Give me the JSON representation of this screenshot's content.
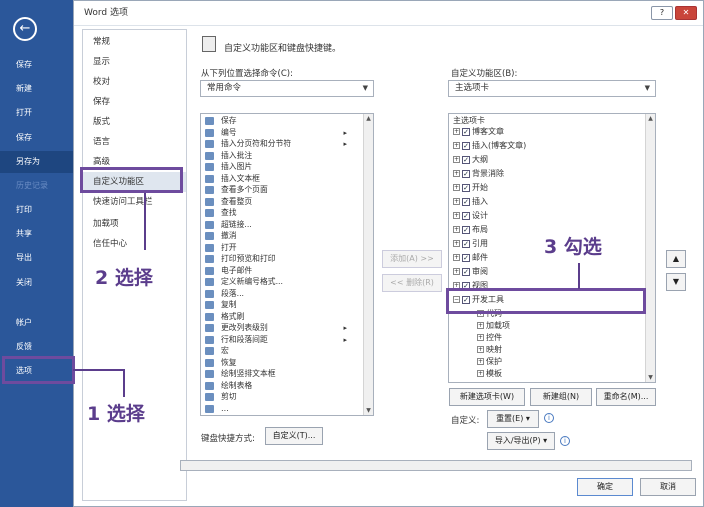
{
  "backstage": {
    "items": [
      "保存",
      "新建",
      "打开",
      "保存",
      "另存为",
      "历史记录",
      "打印",
      "共享",
      "导出",
      "关闭",
      "帐户",
      "反馈",
      "选项"
    ]
  },
  "dialog": {
    "title": "Word 选项",
    "help": "?",
    "close": "✕"
  },
  "nav": [
    "常规",
    "显示",
    "校对",
    "保存",
    "版式",
    "语言",
    "高级",
    "自定义功能区",
    "快速访问工具栏",
    "加载项",
    "信任中心"
  ],
  "header": "自定义功能区和键盘快捷键。",
  "left": {
    "label": "从下列位置选择命令(C):",
    "dropdown": "常用命令",
    "commands": [
      "保存",
      "编号",
      "插入分页符和分节符",
      "插入批注",
      "插入图片",
      "插入文本框",
      "查看多个页面",
      "查看整页",
      "查找",
      "超链接...",
      "撤消",
      "打开",
      "打印预览和打印",
      "电子邮件",
      "定义新编号格式...",
      "段落...",
      "复制",
      "格式刷",
      "更改列表级别",
      "行和段落间距",
      "宏",
      "恢复",
      "绘制竖排文本框",
      "绘制表格",
      "剪切",
      "…"
    ]
  },
  "right": {
    "label": "自定义功能区(B):",
    "dropdown": "主选项卡",
    "root": "主选项卡",
    "tabs": [
      "博客文章",
      "插入(博客文章)",
      "大纲",
      "背景消除",
      "开始",
      "插入",
      "设计",
      "布局",
      "引用",
      "邮件",
      "审阅",
      "视图",
      "开发工具"
    ],
    "children": [
      "代码",
      "加载项",
      "控件",
      "映射",
      "保护",
      "模板"
    ]
  },
  "buttons": {
    "add": "添加(A) >>",
    "remove": "<< 删除(R)",
    "new_tab": "新建选项卡(W)",
    "new_group": "新建组(N)",
    "rename": "重命名(M)...",
    "custom_label": "自定义:",
    "reset": "重置(E) ▾",
    "import_export": "导入/导出(P) ▾",
    "kb_label": "键盘快捷方式:",
    "kb_btn": "自定义(T)...",
    "ok": "确定",
    "cancel": "取消"
  },
  "annotations": [
    "1 选择",
    "2 选择",
    "3 勾选"
  ]
}
